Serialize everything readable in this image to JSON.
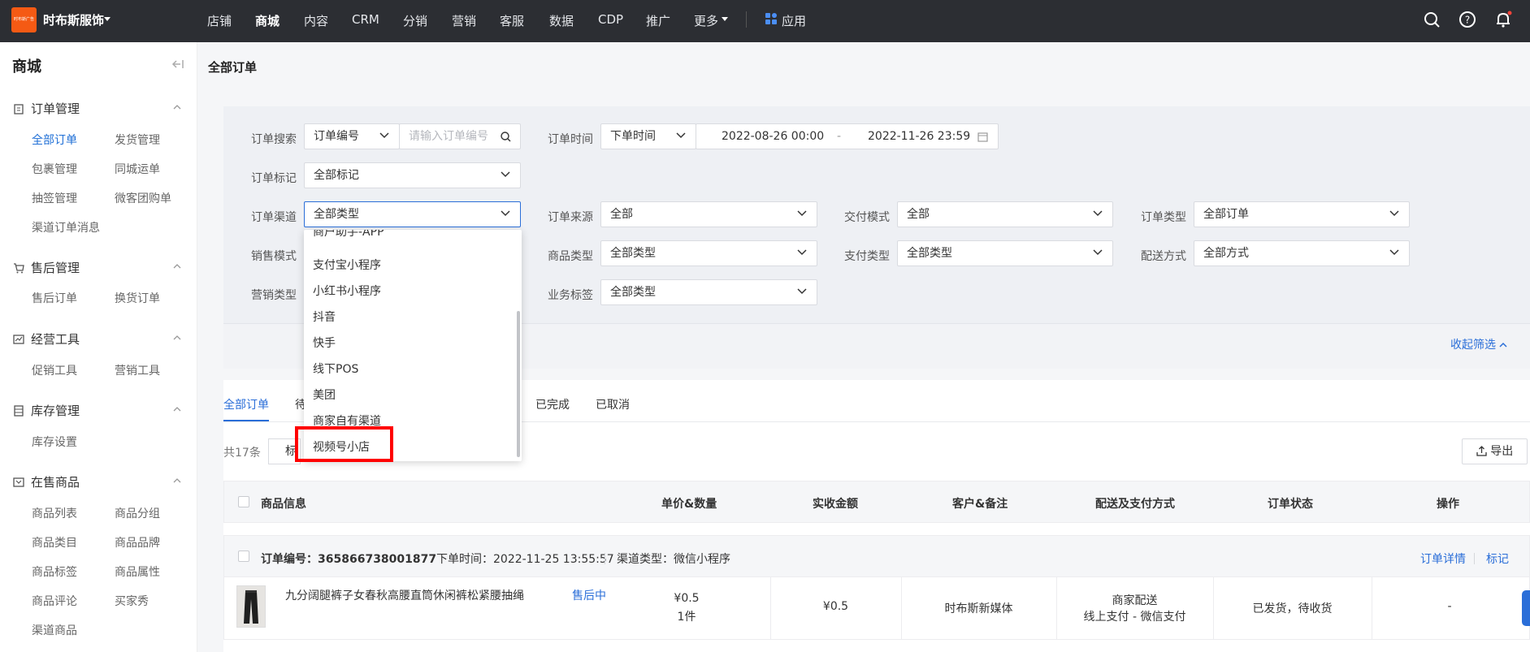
{
  "topbar": {
    "logo_text": "时布斯广告",
    "shop_name": "时布斯服饰",
    "nav": [
      "店铺",
      "商城",
      "内容",
      "CRM",
      "分销",
      "营销",
      "客服",
      "数据",
      "CDP",
      "推广",
      "更多"
    ],
    "active_nav": "商城",
    "apps_label": "应用",
    "icons": [
      "search-icon",
      "help-icon",
      "bell-icon"
    ]
  },
  "sidebar": {
    "title": "商城",
    "groups": [
      {
        "label": "订单管理",
        "items": [
          "全部订单",
          "发货管理",
          "包裹管理",
          "同城运单",
          "抽签管理",
          "微客团购单",
          "渠道订单消息"
        ]
      },
      {
        "label": "售后管理",
        "items": [
          "售后订单",
          "换货订单"
        ]
      },
      {
        "label": "经营工具",
        "items": [
          "促销工具",
          "营销工具"
        ]
      },
      {
        "label": "库存管理",
        "items": [
          "库存设置"
        ]
      },
      {
        "label": "在售商品",
        "items": [
          "商品列表",
          "商品分组",
          "商品类目",
          "商品品牌",
          "商品标签",
          "商品属性",
          "商品评论",
          "买家秀",
          "渠道商品"
        ]
      }
    ],
    "active_item": "全部订单"
  },
  "page": {
    "title": "全部订单"
  },
  "filters": {
    "order_search_label": "订单搜索",
    "order_search_type": "订单编号",
    "order_search_placeholder": "请输入订单编号",
    "order_time_label": "订单时间",
    "order_time_type": "下单时间",
    "date_start": "2022-08-26 00:00",
    "date_sep": "-",
    "date_end": "2022-11-26 23:59",
    "order_mark_label": "订单标记",
    "order_mark_value": "全部标记",
    "order_channel_label": "订单渠道",
    "order_channel_value": "全部类型",
    "order_source_label": "订单来源",
    "order_source_value": "全部",
    "delivery_mode_label": "交付模式",
    "delivery_mode_value": "全部",
    "order_type_label": "订单类型",
    "order_type_value": "全部订单",
    "sales_mode_label": "销售模式",
    "goods_type_label": "商品类型",
    "goods_type_value": "全部类型",
    "pay_type_label": "支付类型",
    "pay_type_value": "全部类型",
    "ship_method_label": "配送方式",
    "ship_method_value": "全部方式",
    "marketing_type_label": "营销类型",
    "biz_tag_label": "业务标签",
    "biz_tag_value": "全部类型",
    "collapse_label": "收起筛选"
  },
  "channel_dropdown": {
    "items": [
      "商户助手-APP",
      "支付宝小程序",
      "小红书小程序",
      "抖音",
      "快手",
      "线下POS",
      "美团",
      "商家自有渠道",
      "视频号小店"
    ],
    "highlighted": "视频号小店"
  },
  "tabs": [
    "全部订单",
    "待",
    "已完成",
    "已取消"
  ],
  "active_tab": "全部订单",
  "list": {
    "count": "共17条",
    "tag_button": "标",
    "export_label": "导出",
    "headers": [
      "商品信息",
      "单价&数量",
      "实收金额",
      "客户&备注",
      "配送及支付方式",
      "订单状态",
      "操作"
    ],
    "order": {
      "order_no": "订单编号：365866738001877",
      "order_time": "下单时间：2022-11-25 13:55:57",
      "channel": "渠道类型：微信小程序",
      "detail_link": "订单详情",
      "mark_link": "标记",
      "product_name": "九分阔腿裤子女春秋高腰直筒休闲裤松紧腰抽绳",
      "after_sale": "售后中",
      "price": "¥0.5",
      "qty": "1件",
      "paid": "¥0.5",
      "customer": "时布斯新媒体",
      "ship": "商家配送",
      "pay": "线上支付 - 微信支付",
      "status": "已发货，待收货",
      "action": "-"
    }
  }
}
